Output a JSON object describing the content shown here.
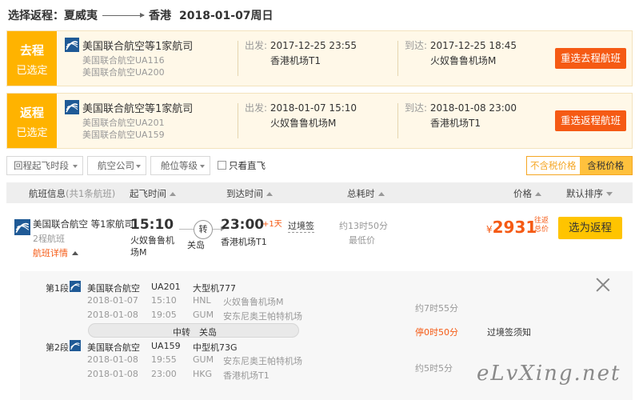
{
  "header": {
    "label": "选择返程：",
    "from": "夏威夷",
    "to": "香港",
    "date": "2018-01-07周日"
  },
  "outbound": {
    "tag": "去程",
    "tag_status": "已选定",
    "airline": "美国联合航空等1家航司",
    "flights": [
      "美国联合航空UA116",
      "美国联合航空UA200"
    ],
    "depart_key": "出发:",
    "depart_time": "2017-12-25 23:55",
    "depart_airport": "香港机场T1",
    "arrive_key": "到达:",
    "arrive_time": "2017-12-25 18:45",
    "arrive_airport": "火奴鲁鲁机场M",
    "reselect": "重选去程航班"
  },
  "return": {
    "tag": "返程",
    "tag_status": "已选定",
    "airline": "美国联合航空等1家航司",
    "flights": [
      "美国联合航空UA201",
      "美国联合航空UA159"
    ],
    "depart_key": "出发:",
    "depart_time": "2018-01-07 15:10",
    "depart_airport": "火奴鲁鲁机场M",
    "arrive_key": "到达:",
    "arrive_time": "2018-01-08 23:00",
    "arrive_airport": "香港机场T1",
    "reselect": "重选返程航班"
  },
  "filters": {
    "dep_time": "回程起飞时段",
    "airline": "航空公司",
    "cabin": "舱位等级",
    "direct_only": "只看直飞",
    "direct_checked": false,
    "tax_excluded": "不含税价格",
    "tax_included": "含税价格"
  },
  "sortbar": {
    "flight_info": "航班信息",
    "count": "(共1条航班)",
    "dep_time": "起飞时间",
    "arr_time": "到达时间",
    "duration": "总耗时",
    "price": "价格",
    "default_sort": "默认排序"
  },
  "result": {
    "airline": "美国联合航空 等1家航司",
    "stops": "2程航班",
    "detail_toggle": "航班详情",
    "dep_time": "15:10",
    "dep_airport": "火奴鲁鲁机场M",
    "transfer_badge": "转",
    "via": "关岛",
    "arr_time": "23:00",
    "next_day": "+1天",
    "arr_airport": "香港机场T1",
    "visa": "过境签",
    "duration": "约13时50分",
    "lowest": "最低价",
    "currency": "¥",
    "price": "2931",
    "price_tag": "往返总价",
    "select": "选为返程"
  },
  "detail": {
    "seg1": {
      "label": "第1段",
      "airline": "美国联合航空",
      "flight": "UA201",
      "aircraft": "大型机777",
      "dep_date": "2018-01-07",
      "dep_time": "15:10",
      "dep_code": "HNL",
      "dep_airport": "火奴鲁鲁机场M",
      "arr_date": "2018-01-08",
      "arr_time": "19:05",
      "arr_code": "GUM",
      "arr_airport": "安东尼奥王帕特机场",
      "duration": "约7时55分"
    },
    "transfer": {
      "label": "中转",
      "city": "关岛",
      "stop": "停0时50分",
      "visa": "过境签须知"
    },
    "seg2": {
      "label": "第2段",
      "airline": "美国联合航空",
      "flight": "UA159",
      "aircraft": "中型机73G",
      "dep_date": "2018-01-08",
      "dep_time": "19:55",
      "dep_code": "GUM",
      "dep_airport": "安东尼奥王帕特机场",
      "arr_date": "2018-01-08",
      "arr_time": "23:00",
      "arr_code": "HKG",
      "arr_airport": "香港机场T1",
      "duration": "约5时5分"
    }
  },
  "watermark": "eLvXing.net",
  "colors": {
    "accent_orange": "#f55a14",
    "tag_yellow": "#ffb300",
    "select_yellow": "#ffc400",
    "airline_blue": "#1f5a96"
  }
}
